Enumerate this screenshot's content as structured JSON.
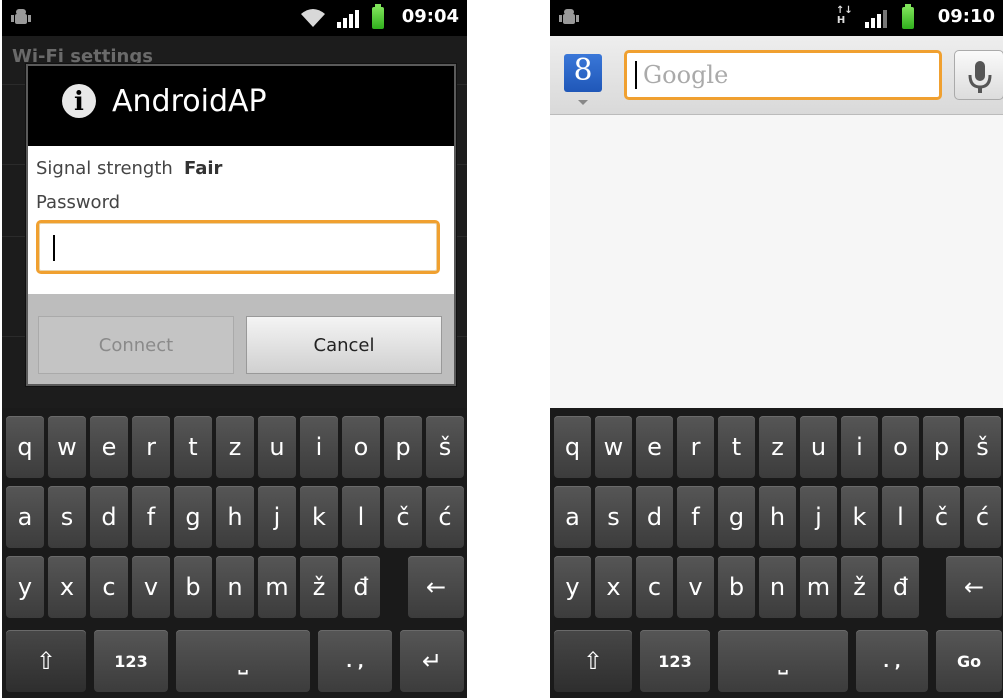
{
  "left_screen": {
    "status_bar": {
      "time": "09:04"
    },
    "background_list": {
      "title": "Wi-Fi settings"
    },
    "dialog": {
      "title": "AndroidAP",
      "signal_label": "Signal strength",
      "signal_value": "Fair",
      "password_label": "Password",
      "password_value": "",
      "buttons": {
        "connect": "Connect",
        "cancel": "Cancel"
      }
    },
    "keyboard": {
      "row1": [
        "q",
        "w",
        "e",
        "r",
        "t",
        "z",
        "u",
        "i",
        "o",
        "p",
        "š"
      ],
      "row2": [
        "a",
        "s",
        "d",
        "f",
        "g",
        "h",
        "j",
        "k",
        "l",
        "č",
        "ć"
      ],
      "row3": [
        "y",
        "x",
        "c",
        "v",
        "b",
        "n",
        "m",
        "ž",
        "đ"
      ],
      "backspace": "←",
      "shift": "⇧",
      "numbers": "123",
      "space": "⎵",
      "punct": ". ,",
      "action": "↵"
    }
  },
  "right_screen": {
    "status_bar": {
      "time": "09:10"
    },
    "search": {
      "placeholder": "Google",
      "badge": "8"
    },
    "keyboard": {
      "row1": [
        "q",
        "w",
        "e",
        "r",
        "t",
        "z",
        "u",
        "i",
        "o",
        "p",
        "š"
      ],
      "row2": [
        "a",
        "s",
        "d",
        "f",
        "g",
        "h",
        "j",
        "k",
        "l",
        "č",
        "ć"
      ],
      "row3": [
        "y",
        "x",
        "c",
        "v",
        "b",
        "n",
        "m",
        "ž",
        "đ"
      ],
      "backspace": "←",
      "shift": "⇧",
      "numbers": "123",
      "space": "⎵",
      "punct": ". ,",
      "action": "Go"
    }
  },
  "colors": {
    "focus_orange": "#f0a030",
    "google_blue": "#1f57b8",
    "battery_green": "#2fae1c"
  }
}
